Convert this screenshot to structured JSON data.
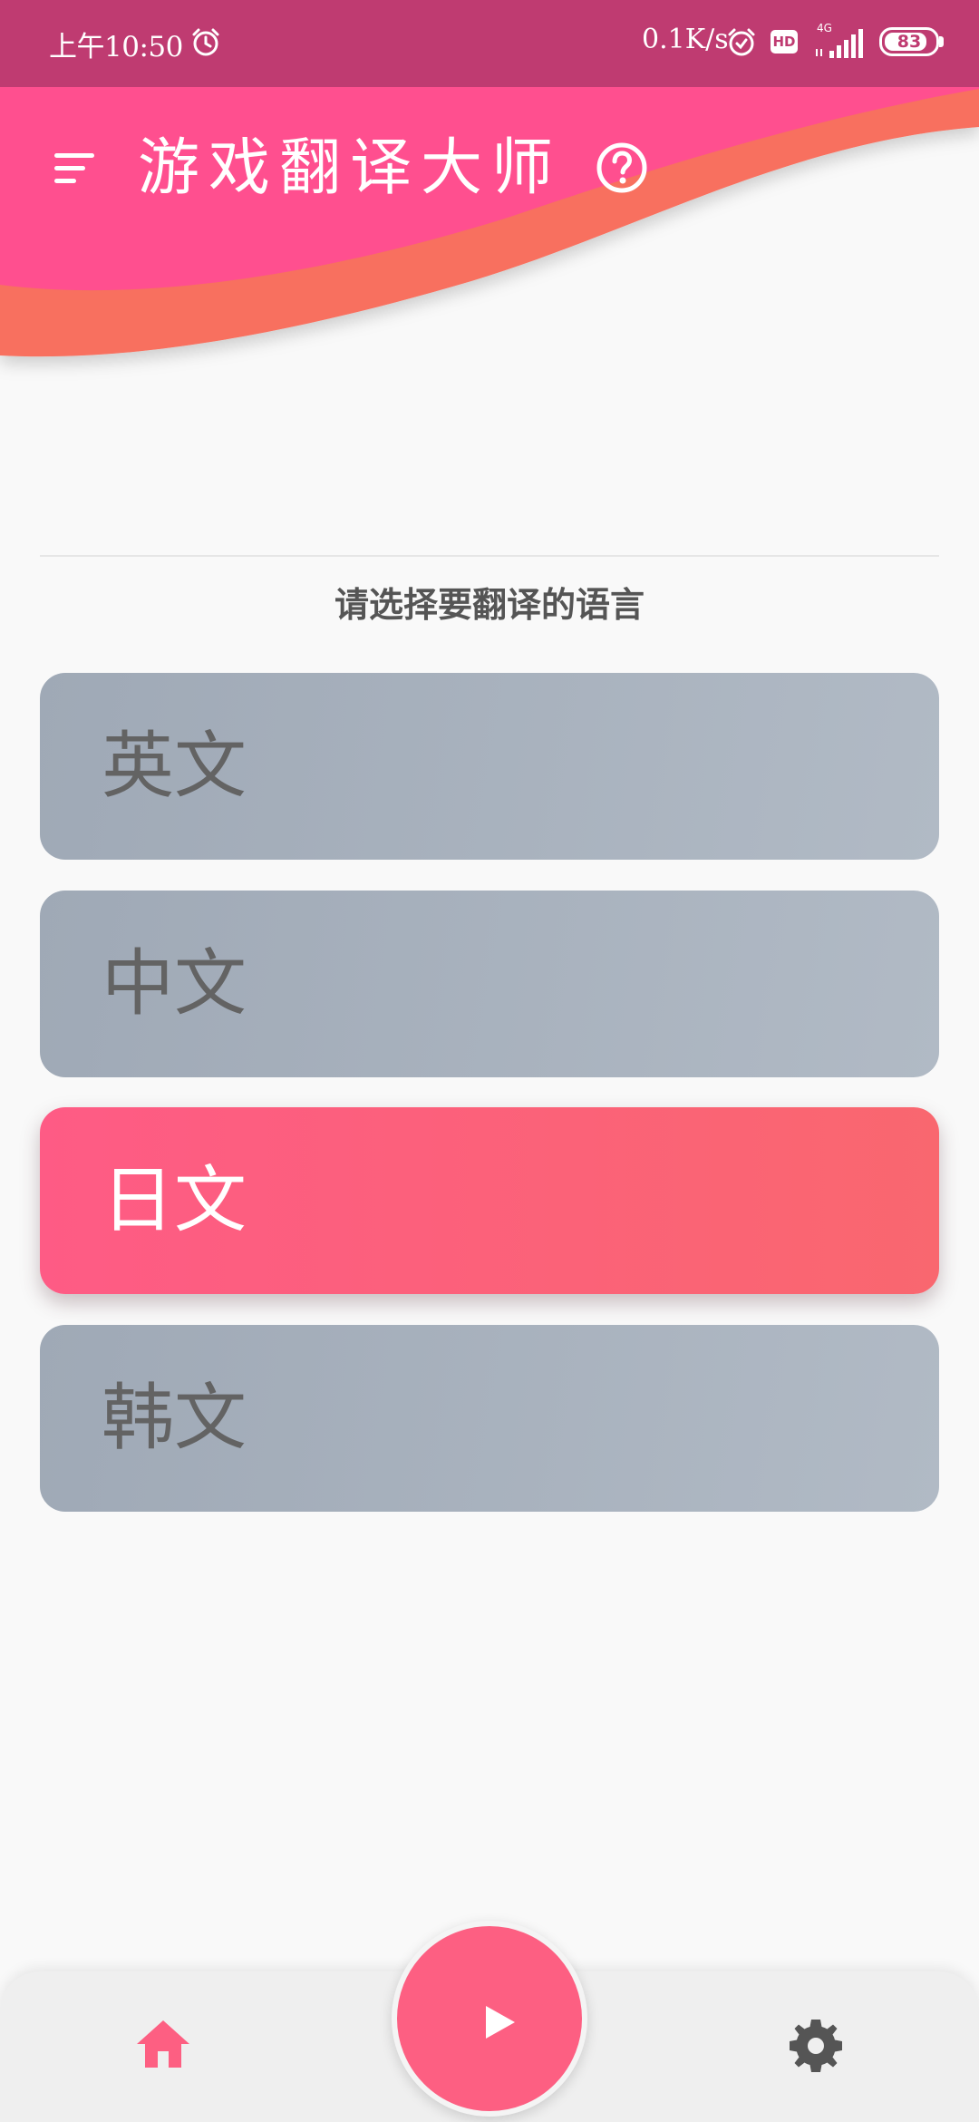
{
  "status_bar": {
    "time": "上午10:50",
    "net_speed": "0.1K/s",
    "hd_badge": "HD",
    "network_type": "4G",
    "battery": "83",
    "icons": [
      "alarm-icon",
      "alarm-icon",
      "signal-icon",
      "battery-icon"
    ]
  },
  "header": {
    "title": "游戏翻译大师",
    "menu_icon": "menu-icon",
    "help_icon": "help-icon"
  },
  "main": {
    "prompt": "请选择要翻译的语言",
    "languages": [
      {
        "label": "英文",
        "selected": false
      },
      {
        "label": "中文",
        "selected": false
      },
      {
        "label": "日文",
        "selected": true
      },
      {
        "label": "韩文",
        "selected": false
      }
    ]
  },
  "bottom_nav": {
    "home_icon": "home-icon",
    "play_icon": "play-icon",
    "settings_icon": "settings-icon"
  },
  "colors": {
    "status_bar": "#bf3b71",
    "header_pink": "#ff4f8f",
    "header_orange": "#f8705e",
    "selected_option": "#fe5b85",
    "unselected_option": "#a6afbb",
    "accent": "#fd5f82",
    "icon_dark": "#555555"
  }
}
